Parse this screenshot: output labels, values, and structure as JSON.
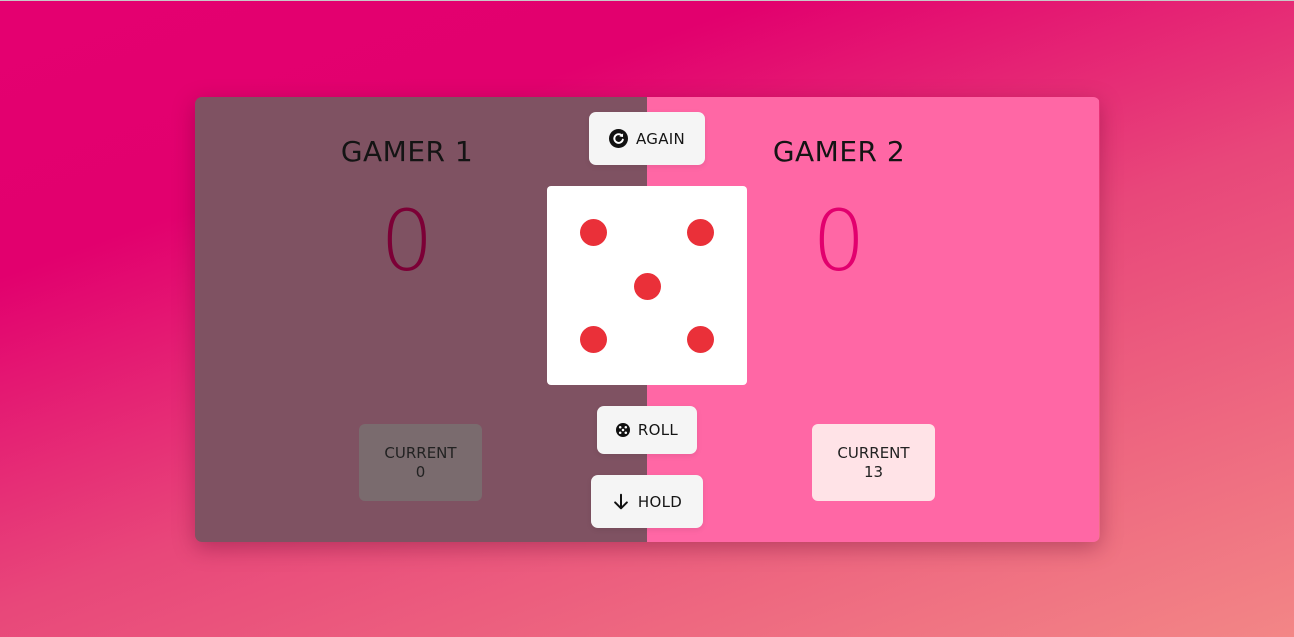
{
  "players": [
    {
      "name": "GAMER 1",
      "score": "0",
      "current_label": "CURRENT",
      "current_value": "0"
    },
    {
      "name": "GAMER 2",
      "score": "0",
      "current_label": "CURRENT",
      "current_value": "13"
    }
  ],
  "controls": {
    "again_label": "AGAIN",
    "again_icon": "refresh-icon",
    "roll_label": "ROLL",
    "roll_icon": "dice-icon",
    "hold_label": "HOLD",
    "hold_icon": "arrow-down-icon"
  },
  "dice": {
    "value": 5,
    "pip_color": "#ea3039"
  },
  "colors": {
    "player1_panel": "#7f5262",
    "player2_panel": "#ff67a5",
    "player1_score": "#7c0036",
    "player2_score": "#e2006e"
  }
}
